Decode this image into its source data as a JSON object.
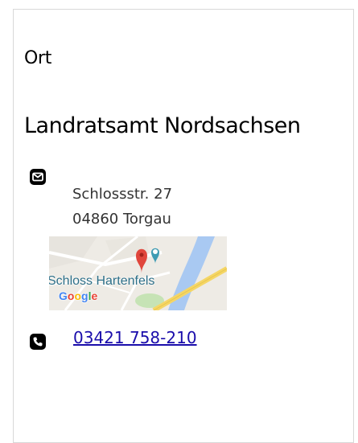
{
  "section": {
    "label": "Ort"
  },
  "location": {
    "name": "Landratsamt Nordsachsen",
    "address": {
      "street": "Schlossstr. 27",
      "city": "04860 Torgau"
    },
    "map": {
      "place_label": "Schloss Hartenfels",
      "provider": "Google"
    },
    "phone": "03421 758-210"
  },
  "icons": {
    "address": "envelope-icon",
    "phone": "phone-icon"
  },
  "colors": {
    "link": "#1a0dab",
    "map_river": "#a9c9f2",
    "map_road": "#f5d665",
    "map_pin": "#e0463c",
    "map_poi": "#3e9bb3"
  }
}
